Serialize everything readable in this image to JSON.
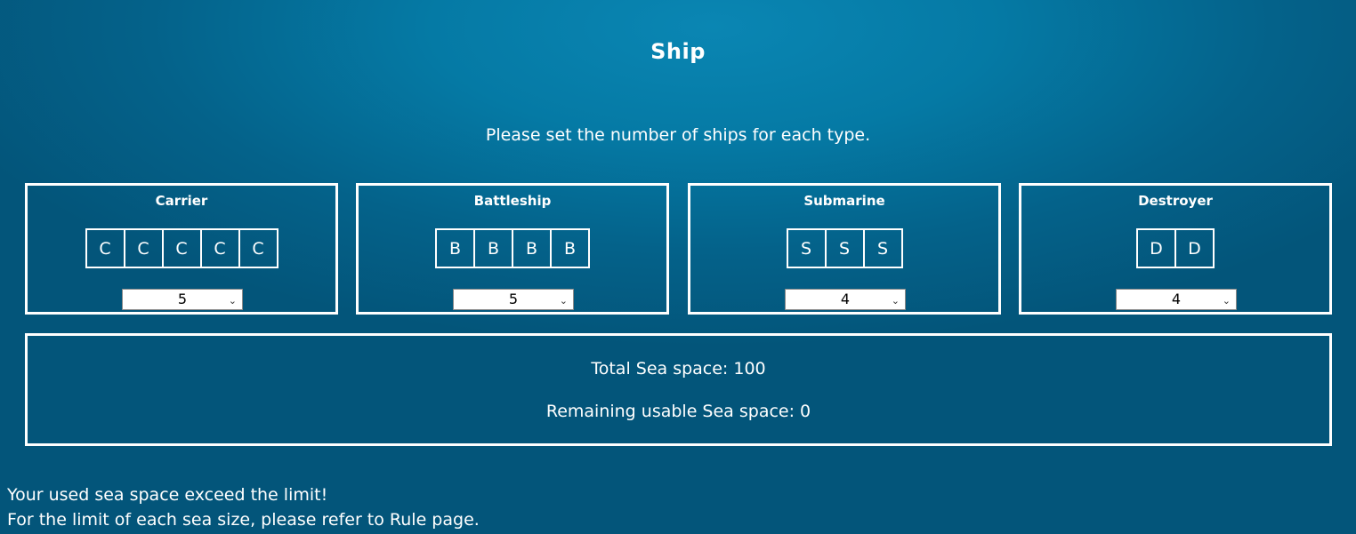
{
  "page": {
    "title": "Ship",
    "instruction": "Please set the number of ships for each type."
  },
  "ships": [
    {
      "name": "Carrier",
      "letter": "C",
      "size": 5,
      "count": "5",
      "cells": [
        "C",
        "C",
        "C",
        "C",
        "C"
      ]
    },
    {
      "name": "Battleship",
      "letter": "B",
      "size": 4,
      "count": "5",
      "cells": [
        "B",
        "B",
        "B",
        "B"
      ]
    },
    {
      "name": "Submarine",
      "letter": "S",
      "size": 3,
      "count": "4",
      "cells": [
        "S",
        "S",
        "S"
      ]
    },
    {
      "name": "Destroyer",
      "letter": "D",
      "size": 2,
      "count": "4",
      "cells": [
        "D",
        "D"
      ]
    }
  ],
  "summary": {
    "total_label": "Total Sea space: 100",
    "remaining_label": "Remaining usable Sea space: 0"
  },
  "warning": {
    "line1": "Your used sea space exceed the limit!",
    "line2": "For the limit of each sea size, please refer to Rule page."
  },
  "colors": {
    "background": "#04628a",
    "border": "#ffffff",
    "text": "#ffffff"
  },
  "icons": {
    "select_arrow": "chevron-down-icon"
  }
}
